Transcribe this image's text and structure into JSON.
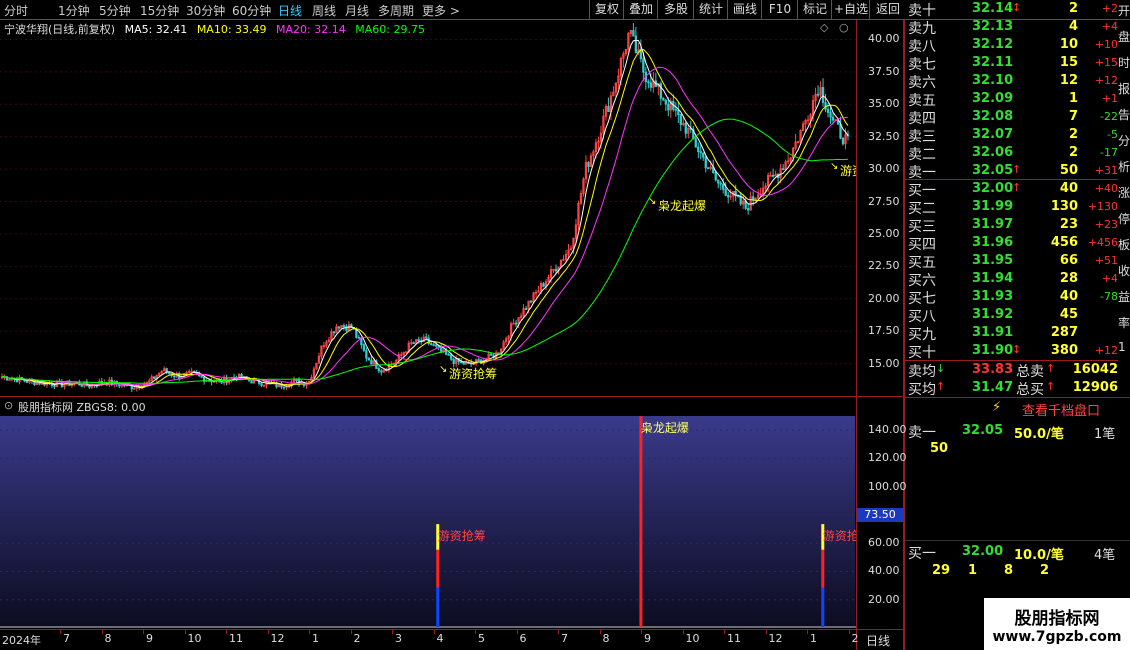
{
  "toolbar": {
    "periods": [
      "分时",
      "1分钟",
      "5分钟",
      "15分钟",
      "30分钟",
      "60分钟",
      "日线",
      "周线",
      "月线",
      "多周期",
      "更多 >"
    ],
    "active_period": "日线",
    "buttons": [
      "复权",
      "叠加",
      "多股",
      "统计",
      "画线",
      "F10",
      "标记",
      "+自选",
      "返回"
    ]
  },
  "chart_header": {
    "stock_label": "宁波华翔(日线,前复权)",
    "ma5": "MA5: 32.41",
    "ma10": "MA10: 33.49",
    "ma20": "MA20: 32.14",
    "ma60": "MA60: 29.75"
  },
  "colors": {
    "ma5": "#ffffff",
    "ma10": "#ffff00",
    "ma20": "#ff33ff",
    "ma60": "#00ff00",
    "up": "#ff4444",
    "down": "#33cccc",
    "separator": "#9a1c1c"
  },
  "chart_data": [
    {
      "type": "candlestick",
      "ylim": [
        12.5,
        41.5
      ],
      "y_ticks": [
        "40.00",
        "37.50",
        "35.00",
        "32.50",
        "30.00",
        "27.50",
        "25.00",
        "22.50",
        "20.00",
        "17.50",
        "15.00"
      ],
      "annotations": [
        "游资抢筹",
        "枭龙起爆",
        "游资"
      ],
      "close_path": [
        14.0,
        13.8,
        13.6,
        13.5,
        13.4,
        13.5,
        13.3,
        13.6,
        13.4,
        13.2,
        13.5,
        14.5,
        14.0,
        14.2,
        13.8,
        13.6,
        14.0,
        13.7,
        13.5,
        13.3,
        13.6,
        13.5,
        16.5,
        18.0,
        17.8,
        15.5,
        14.5,
        15.2,
        16.5,
        16.8,
        16.0,
        15.2,
        14.9,
        15.3,
        15.8,
        18.0,
        19.5,
        21.0,
        22.5,
        24.0,
        30.0,
        33.0,
        36.5,
        40.5,
        37.5,
        36.0,
        34.5,
        33.0,
        31.0,
        29.0,
        28.0,
        27.0,
        28.5,
        29.5,
        31.0,
        33.5,
        36.5,
        33.5,
        32.0
      ]
    },
    {
      "type": "bar",
      "title": "股朋指标网 ZBGS8: 0.00",
      "ylim": [
        0,
        150
      ],
      "y_ticks": [
        "140.00",
        "120.00",
        "100.00",
        "80.00",
        "60.00",
        "40.00",
        "20.00"
      ],
      "cursor_value": "73.50",
      "signals": [
        {
          "label": "游资抢筹",
          "position": 0.515,
          "value": 73.5
        },
        {
          "label": "枭龙起爆",
          "position": 0.754,
          "value": 150
        },
        {
          "label": "游资抢",
          "position": 0.968,
          "value": 73.5
        }
      ]
    }
  ],
  "date_axis": [
    "2024年",
    "7",
    "8",
    "9",
    "10",
    "11",
    "12",
    "1",
    "2",
    "3",
    "4",
    "5",
    "6",
    "7",
    "8",
    "9",
    "10",
    "11",
    "12",
    "1",
    "2"
  ],
  "period_label": "日线",
  "orderbook": {
    "asks": [
      {
        "label": "卖十",
        "price": "32.14",
        "mark": "↕",
        "vol": "2",
        "chg": "+2"
      },
      {
        "label": "卖九",
        "price": "32.13",
        "mark": "",
        "vol": "4",
        "chg": "+4"
      },
      {
        "label": "卖八",
        "price": "32.12",
        "mark": "",
        "vol": "10",
        "chg": "+10"
      },
      {
        "label": "卖七",
        "price": "32.11",
        "mark": "",
        "vol": "15",
        "chg": "+15"
      },
      {
        "label": "卖六",
        "price": "32.10",
        "mark": "",
        "vol": "12",
        "chg": "+12"
      },
      {
        "label": "卖五",
        "price": "32.09",
        "mark": "",
        "vol": "1",
        "chg": "+1"
      },
      {
        "label": "卖四",
        "price": "32.08",
        "mark": "",
        "vol": "7",
        "chg": "-22"
      },
      {
        "label": "卖三",
        "price": "32.07",
        "mark": "",
        "vol": "2",
        "chg": "-5"
      },
      {
        "label": "卖二",
        "price": "32.06",
        "mark": "",
        "vol": "2",
        "chg": "-17"
      },
      {
        "label": "卖一",
        "price": "32.05",
        "mark": "↑",
        "vol": "50",
        "chg": "+31"
      }
    ],
    "bids": [
      {
        "label": "买一",
        "price": "32.00",
        "mark": "↑",
        "vol": "40",
        "chg": "+40"
      },
      {
        "label": "买二",
        "price": "31.99",
        "mark": "",
        "vol": "130",
        "chg": "+130"
      },
      {
        "label": "买三",
        "price": "31.97",
        "mark": "",
        "vol": "23",
        "chg": "+23"
      },
      {
        "label": "买四",
        "price": "31.96",
        "mark": "",
        "vol": "456",
        "chg": "+456"
      },
      {
        "label": "买五",
        "price": "31.95",
        "mark": "",
        "vol": "66",
        "chg": "+51"
      },
      {
        "label": "买六",
        "price": "31.94",
        "mark": "",
        "vol": "28",
        "chg": "+4"
      },
      {
        "label": "买七",
        "price": "31.93",
        "mark": "",
        "vol": "40",
        "chg": "-78"
      },
      {
        "label": "买八",
        "price": "31.92",
        "mark": "",
        "vol": "45",
        "chg": ""
      },
      {
        "label": "买九",
        "price": "31.91",
        "mark": "",
        "vol": "287",
        "chg": ""
      },
      {
        "label": "买十",
        "price": "31.90",
        "mark": "↕",
        "vol": "380",
        "chg": "+12"
      }
    ],
    "summary": {
      "ask_avg_label": "卖均",
      "ask_avg_mark": "↓",
      "ask_avg": "33.83",
      "ask_total_label": "总卖",
      "ask_total_mark": "↑",
      "ask_total": "16042",
      "bid_avg_label": "买均",
      "bid_avg_mark": "↑",
      "bid_avg": "31.47",
      "bid_total_label": "总买",
      "bid_total_mark": "↑",
      "bid_total": "12906"
    },
    "qiandang_button": "查看千档盘口",
    "ask1_detail": {
      "label": "卖一",
      "price": "32.05",
      "per": "50.0/笔",
      "count": "1笔",
      "orders": [
        "50"
      ]
    },
    "bid1_detail": {
      "label": "买一",
      "price": "32.00",
      "per": "10.0/笔",
      "count": "4笔",
      "orders": [
        "29",
        "1",
        "8",
        "2"
      ]
    }
  },
  "side_strip": [
    "开",
    "盘",
    "时",
    "报",
    "告",
    "分",
    "析",
    "涨",
    "停",
    "板",
    "收",
    "益",
    "率",
    "1"
  ],
  "watermark": {
    "cn": "股朋指标网",
    "url": "www.7gpzb.com"
  }
}
